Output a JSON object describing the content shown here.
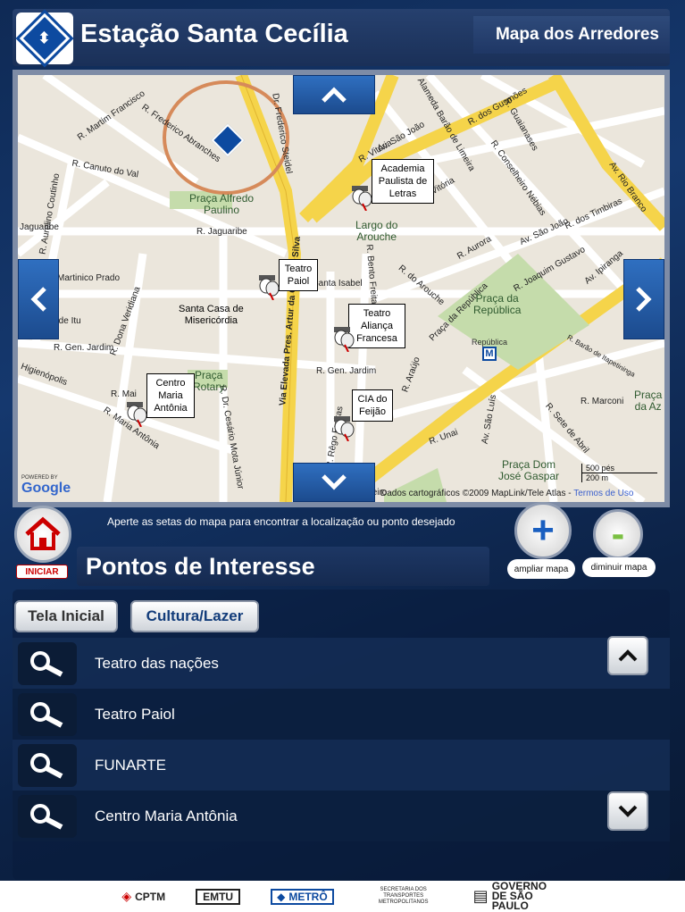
{
  "header": {
    "station_title": "Estação Santa Cecília",
    "section_right": "Mapa dos Arredores"
  },
  "map": {
    "streets": [
      {
        "label": "R. Martim Francisco"
      },
      {
        "label": "R. Frederico Abranches"
      },
      {
        "label": "R. Canuto do Val"
      },
      {
        "label": "R. Aurelino Coutinho"
      },
      {
        "label": "R. Jaguaribe"
      },
      {
        "label": "Jaguaribe"
      },
      {
        "label": "Martinico Prado"
      },
      {
        "label": "R. Dona Veridiana"
      },
      {
        "label": "Marquês de Itu"
      },
      {
        "label": "R. Gen. Jardim"
      },
      {
        "label": "Higienópolis"
      },
      {
        "label": "R. Mai"
      },
      {
        "label": "R. Maria Antônia"
      },
      {
        "label": "R. Dr. Cesário Mota Júnior"
      },
      {
        "label": "Via Elevada Pres. Artur da Costa E Silva"
      },
      {
        "label": "Dr. Frederico Steidel"
      },
      {
        "label": "Alameda Barão de Limeira"
      },
      {
        "label": "R. dos Gusmões"
      },
      {
        "label": "R. Guaianases"
      },
      {
        "label": "R. Conselheiro Nébias"
      },
      {
        "label": "R. Vitória"
      },
      {
        "label": "Av. Rio Branco"
      },
      {
        "label": "R. Aurora"
      },
      {
        "label": "Av. São João"
      },
      {
        "label": "R. Joaquim Gustavo"
      },
      {
        "label": "Av. Ipiranga"
      },
      {
        "label": "R. do Arouche"
      },
      {
        "label": "Praça da República"
      },
      {
        "label": "R. Bento Freitas"
      },
      {
        "label": "R. Barão de Itapetininga"
      },
      {
        "label": "R. Marconi"
      },
      {
        "label": "R. Sete de Abril"
      },
      {
        "label": "R. Rêgo Freitas"
      },
      {
        "label": "R. Araújo"
      },
      {
        "label": "R. Unai"
      },
      {
        "label": "Av. São Luís"
      },
      {
        "label": "Santa Isabel"
      },
      {
        "label": "R. Gen. Jardim"
      },
      {
        "label": "Conselheiro"
      },
      {
        "label": "R. dos Timbiras"
      },
      {
        "label": "R. Vitória"
      },
      {
        "label": "Av. São João"
      }
    ],
    "places": {
      "praca_alfredo": "Praça Alfredo\nPaulino",
      "santa_casa": "Santa Casa de\nMisericórdia",
      "largo_arouche": "Largo do\nArouche",
      "praca_republica": "Praça da\nRepública",
      "republica_station": "República",
      "praca_rotary": "Praça\nRotary",
      "praca_dom_jose": "Praça Dom\nJosé Gaspar",
      "praca_az": "Praça\nda Az"
    },
    "pois": [
      {
        "label": "Academia Paulista de Letras"
      },
      {
        "label": "Teatro Paiol"
      },
      {
        "label": "Teatro Aliança Francesa"
      },
      {
        "label": "Centro Maria Antônia"
      },
      {
        "label": "CIA do Feijão"
      }
    ],
    "scale": {
      "top": "500 pés",
      "bottom": "200 m"
    },
    "copyright": "Dados cartográficos ©2009 MapLink/Tele Atlas -",
    "terms": "Termos de Uso",
    "google_powered": "POWERED BY",
    "google": "Google"
  },
  "instruction": "Aperte as setas do mapa para encontrar a localização ou ponto desejado",
  "home": {
    "label": "INICIAR"
  },
  "zoom": {
    "in_symbol": "+",
    "in_label": "ampliar mapa",
    "out_symbol": "-",
    "out_label": "diminuir mapa"
  },
  "section": {
    "title": "Pontos de Interesse"
  },
  "tabs": [
    {
      "label": "Tela Inicial"
    },
    {
      "label": "Cultura/Lazer"
    }
  ],
  "list": [
    {
      "label": "Teatro das nações"
    },
    {
      "label": "Teatro Paiol"
    },
    {
      "label": "FUNARTE"
    },
    {
      "label": "Centro Maria Antônia"
    }
  ],
  "footer": {
    "cptm": "CPTM",
    "emtu": "EMTU",
    "metro": "METRÔ",
    "secretaria": "SECRETARIA DOS TRANSPORTES METROPOLITANOS",
    "governo": "GOVERNO DE SÃO PAULO"
  },
  "colors": {
    "brand_blue": "#0d4aa0",
    "map_bg": "#ebe6dc",
    "major_road": "#f5d44a",
    "home_red": "#cc0000",
    "zoom_in": "#1a5fc0",
    "zoom_out": "#7bc043"
  }
}
